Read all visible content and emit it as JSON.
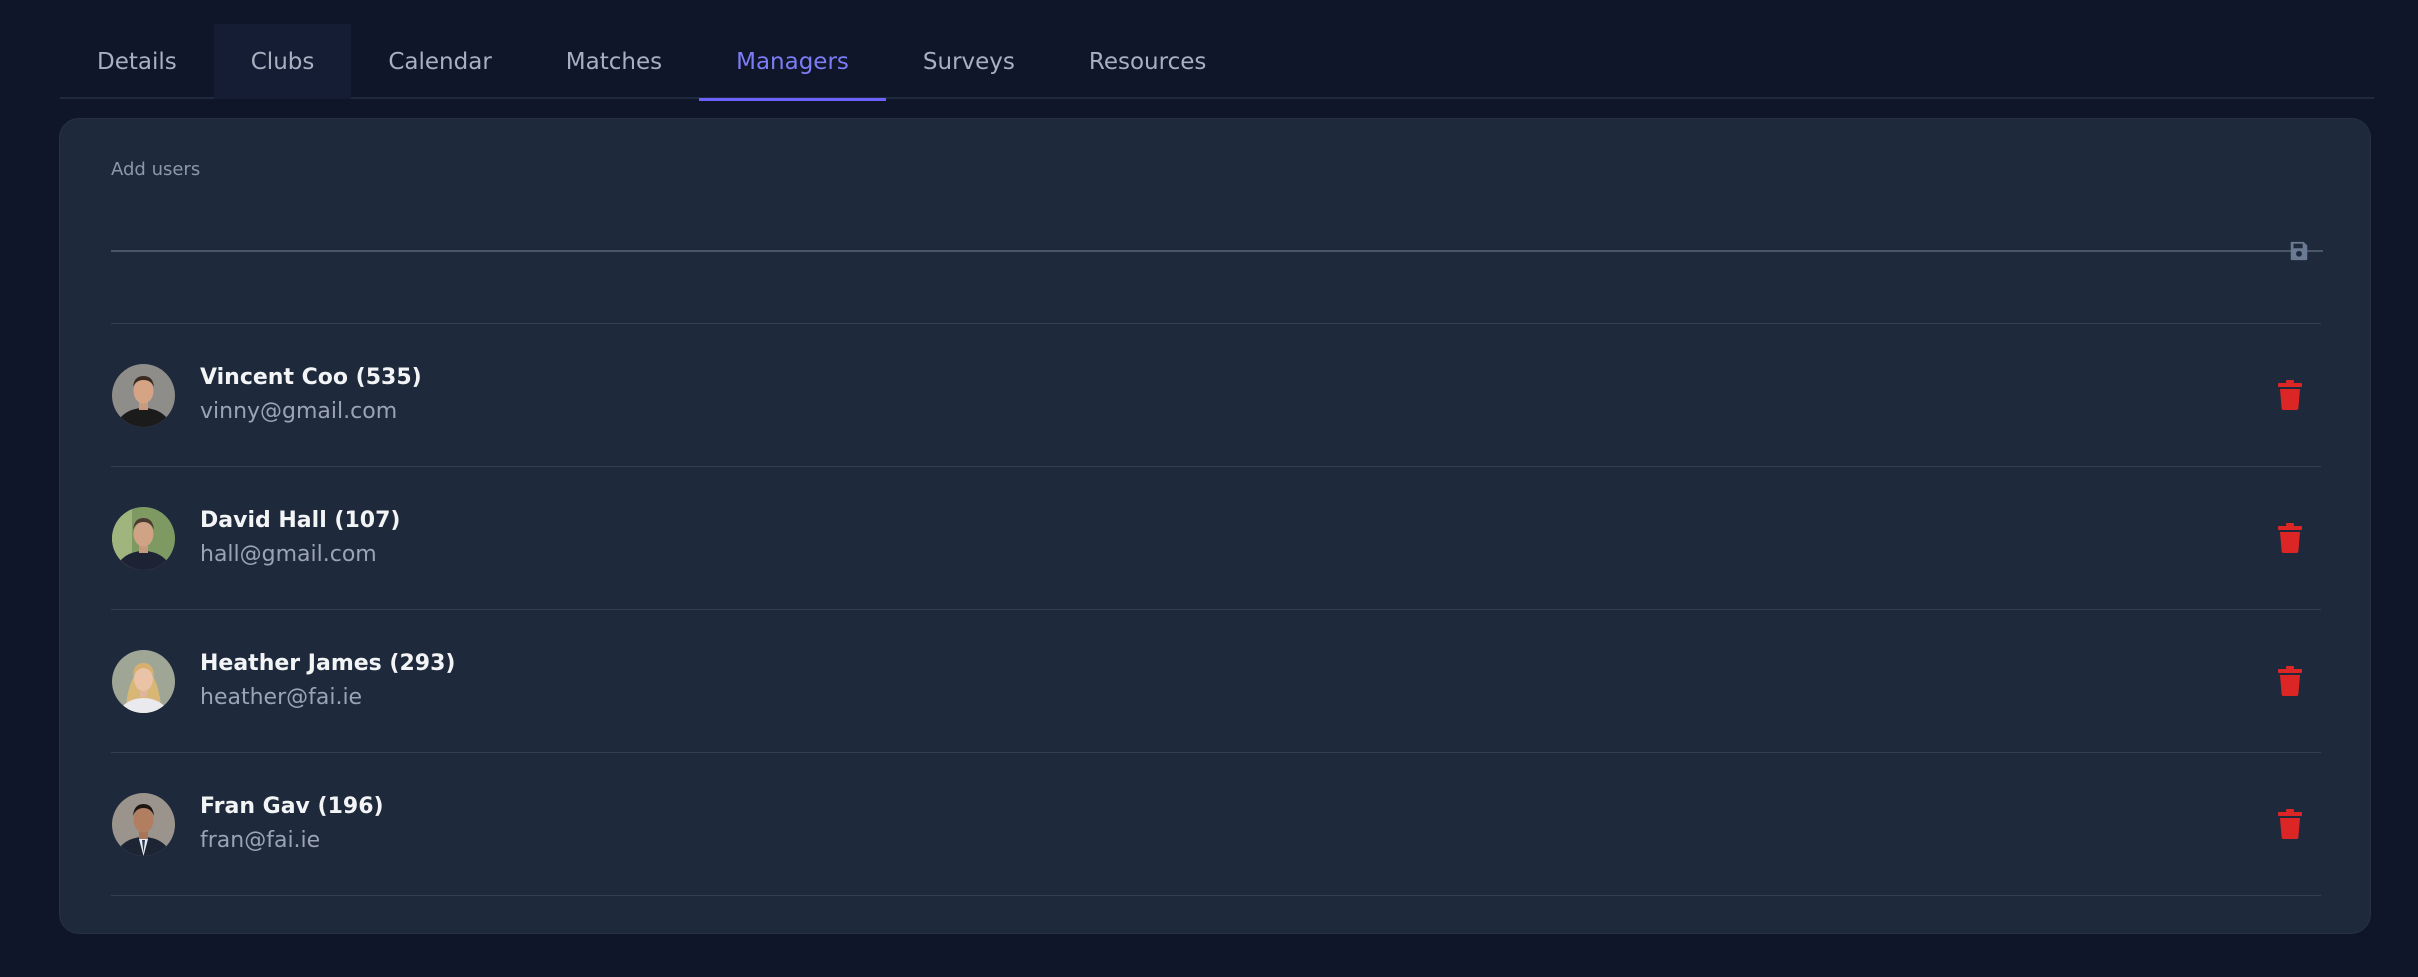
{
  "tabs": [
    {
      "label": "Details"
    },
    {
      "label": "Clubs"
    },
    {
      "label": "Calendar"
    },
    {
      "label": "Matches"
    },
    {
      "label": "Managers"
    },
    {
      "label": "Surveys"
    },
    {
      "label": "Resources"
    }
  ],
  "active_tab": "Managers",
  "add_users": {
    "label": "Add users",
    "value": ""
  },
  "managers": [
    {
      "name": "Vincent Coo (535)",
      "email": "vinny@gmail.com"
    },
    {
      "name": "David Hall (107)",
      "email": "hall@gmail.com"
    },
    {
      "name": "Heather James (293)",
      "email": "heather@fai.ie"
    },
    {
      "name": "Fran Gav (196)",
      "email": "fran@fai.ie"
    }
  ],
  "colors": {
    "background": "#0f1629",
    "card": "#1e293b",
    "accent": "#6c63ff",
    "delete": "#dc2626"
  },
  "icons": {
    "save": "save-icon",
    "delete": "trash-icon"
  }
}
